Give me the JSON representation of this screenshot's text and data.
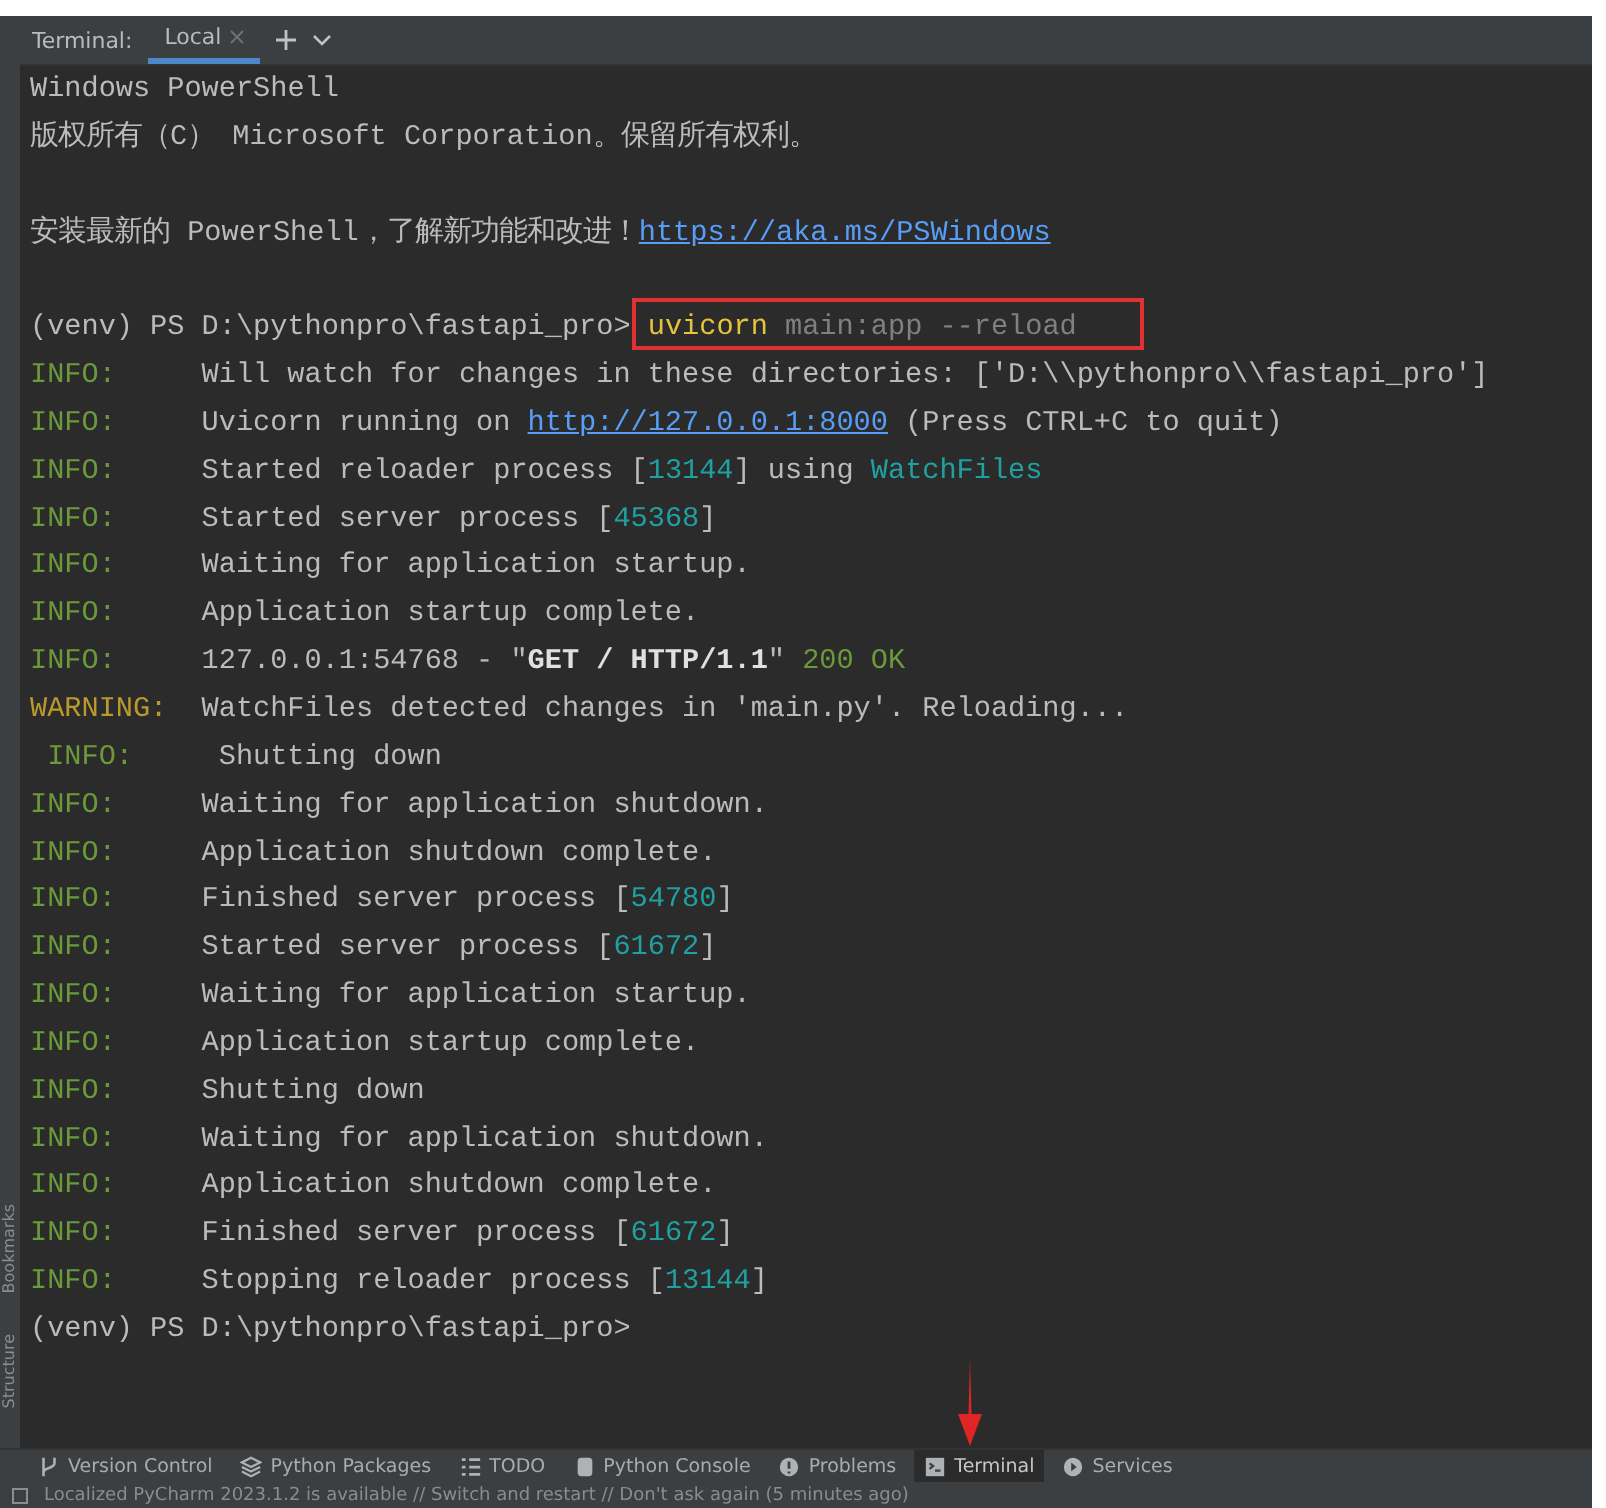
{
  "tool_window": {
    "label": "Terminal:",
    "tabs": [
      {
        "label": "Local",
        "selected": true
      }
    ]
  },
  "side_strip": [
    "Bookmarks",
    "Structure"
  ],
  "lines": [
    {
      "kind": "output",
      "segments": [
        {
          "kind": "text",
          "text": "Windows PowerShell"
        }
      ]
    },
    {
      "kind": "output",
      "segments": [
        {
          "kind": "text",
          "text": "版权所有（C） Microsoft Corporation。保留所有权利。"
        }
      ]
    },
    {
      "kind": "blank"
    },
    {
      "kind": "output",
      "segments": [
        {
          "kind": "text",
          "text": "安装最新的 PowerShell，了解新功能和改进！"
        },
        {
          "kind": "link",
          "text": "https://aka.ms/PSWindows"
        }
      ]
    },
    {
      "kind": "blank"
    },
    {
      "kind": "output",
      "highlighted": true,
      "segments": [
        {
          "kind": "text",
          "text": "(venv) PS D:\\pythonpro\\fastapi_pro> "
        },
        {
          "kind": "cmd",
          "text": "uvicorn"
        },
        {
          "kind": "arg",
          "text": " main:app --reload"
        }
      ]
    },
    {
      "kind": "output",
      "segments": [
        {
          "kind": "info",
          "text": "INFO:"
        },
        {
          "kind": "text",
          "text": "Will watch for changes in these directories: ['D:\\\\pythonpro\\\\fastapi_pro']"
        }
      ]
    },
    {
      "kind": "output",
      "segments": [
        {
          "kind": "info",
          "text": "INFO:"
        },
        {
          "kind": "text",
          "text": "Uvicorn running on "
        },
        {
          "kind": "link",
          "text": "http://127.0.0.1:8000"
        },
        {
          "kind": "text",
          "text": " (Press CTRL+C to quit)"
        }
      ]
    },
    {
      "kind": "output",
      "segments": [
        {
          "kind": "info",
          "text": "INFO:"
        },
        {
          "kind": "text",
          "text": "Started reloader process ["
        },
        {
          "kind": "num",
          "text": "13144"
        },
        {
          "kind": "text",
          "text": "] using "
        },
        {
          "kind": "num",
          "text": "WatchFiles"
        }
      ]
    },
    {
      "kind": "output",
      "segments": [
        {
          "kind": "info",
          "text": "INFO:"
        },
        {
          "kind": "text",
          "text": "Started server process ["
        },
        {
          "kind": "num",
          "text": "45368"
        },
        {
          "kind": "text",
          "text": "]"
        }
      ]
    },
    {
      "kind": "output",
      "segments": [
        {
          "kind": "info",
          "text": "INFO:"
        },
        {
          "kind": "text",
          "text": "Waiting for application startup."
        }
      ]
    },
    {
      "kind": "output",
      "segments": [
        {
          "kind": "info",
          "text": "INFO:"
        },
        {
          "kind": "text",
          "text": "Application startup complete."
        }
      ]
    },
    {
      "kind": "output",
      "segments": [
        {
          "kind": "info",
          "text": "INFO:"
        },
        {
          "kind": "text",
          "text": "127.0.0.1:54768 - \""
        },
        {
          "kind": "bold",
          "text": "GET / HTTP/1.1"
        },
        {
          "kind": "text",
          "text": "\" "
        },
        {
          "kind": "ok",
          "text": "200 OK"
        }
      ]
    },
    {
      "kind": "output",
      "segments": [
        {
          "kind": "warning",
          "text": "WARNING:"
        },
        {
          "kind": "text",
          "text": "WatchFiles detected changes in 'main.py'. Reloading..."
        }
      ]
    },
    {
      "kind": "output",
      "segments": [
        {
          "kind": "info",
          "text": " INFO:"
        },
        {
          "kind": "text",
          "text": " Shutting down"
        }
      ]
    },
    {
      "kind": "output",
      "segments": [
        {
          "kind": "info",
          "text": "INFO:"
        },
        {
          "kind": "text",
          "text": "Waiting for application shutdown."
        }
      ]
    },
    {
      "kind": "output",
      "segments": [
        {
          "kind": "info",
          "text": "INFO:"
        },
        {
          "kind": "text",
          "text": "Application shutdown complete."
        }
      ]
    },
    {
      "kind": "output",
      "segments": [
        {
          "kind": "info",
          "text": "INFO:"
        },
        {
          "kind": "text",
          "text": "Finished server process ["
        },
        {
          "kind": "num",
          "text": "54780"
        },
        {
          "kind": "text",
          "text": "]"
        }
      ]
    },
    {
      "kind": "output",
      "segments": [
        {
          "kind": "info",
          "text": "INFO:"
        },
        {
          "kind": "text",
          "text": "Started server process ["
        },
        {
          "kind": "num",
          "text": "61672"
        },
        {
          "kind": "text",
          "text": "]"
        }
      ]
    },
    {
      "kind": "output",
      "segments": [
        {
          "kind": "info",
          "text": "INFO:"
        },
        {
          "kind": "text",
          "text": "Waiting for application startup."
        }
      ]
    },
    {
      "kind": "output",
      "segments": [
        {
          "kind": "info",
          "text": "INFO:"
        },
        {
          "kind": "text",
          "text": "Application startup complete."
        }
      ]
    },
    {
      "kind": "output",
      "segments": [
        {
          "kind": "info",
          "text": "INFO:"
        },
        {
          "kind": "text",
          "text": "Shutting down"
        }
      ]
    },
    {
      "kind": "output",
      "segments": [
        {
          "kind": "info",
          "text": "INFO:"
        },
        {
          "kind": "text",
          "text": "Waiting for application shutdown."
        }
      ]
    },
    {
      "kind": "output",
      "segments": [
        {
          "kind": "info",
          "text": "INFO:"
        },
        {
          "kind": "text",
          "text": "Application shutdown complete."
        }
      ]
    },
    {
      "kind": "output",
      "segments": [
        {
          "kind": "info",
          "text": "INFO:"
        },
        {
          "kind": "text",
          "text": "Finished server process ["
        },
        {
          "kind": "num",
          "text": "61672"
        },
        {
          "kind": "text",
          "text": "]"
        }
      ]
    },
    {
      "kind": "output",
      "segments": [
        {
          "kind": "info",
          "text": "INFO:"
        },
        {
          "kind": "text",
          "text": "Stopping reloader process ["
        },
        {
          "kind": "num",
          "text": "13144"
        },
        {
          "kind": "text",
          "text": "]"
        }
      ]
    },
    {
      "kind": "output",
      "segments": [
        {
          "kind": "text",
          "text": "(venv) PS D:\\pythonpro\\fastapi_pro>"
        }
      ]
    }
  ],
  "tool_bar": [
    {
      "kind": "vcs",
      "label": "Version Control",
      "selected": false,
      "marked": false
    },
    {
      "kind": "packages",
      "label": "Python Packages",
      "selected": false,
      "marked": false
    },
    {
      "kind": "todo",
      "label": "TODO",
      "selected": false,
      "marked": false
    },
    {
      "kind": "console",
      "label": "Python Console",
      "selected": false,
      "marked": false
    },
    {
      "kind": "problems",
      "label": "Problems",
      "selected": false,
      "marked": false
    },
    {
      "kind": "terminal",
      "label": "Terminal",
      "selected": true,
      "marked": true
    },
    {
      "kind": "services",
      "label": "Services",
      "selected": false,
      "marked": false
    }
  ],
  "status_bar": {
    "message": "Localized PyCharm 2023.1.2 is available // Switch and restart // Don't ask again (5 minutes ago)"
  }
}
